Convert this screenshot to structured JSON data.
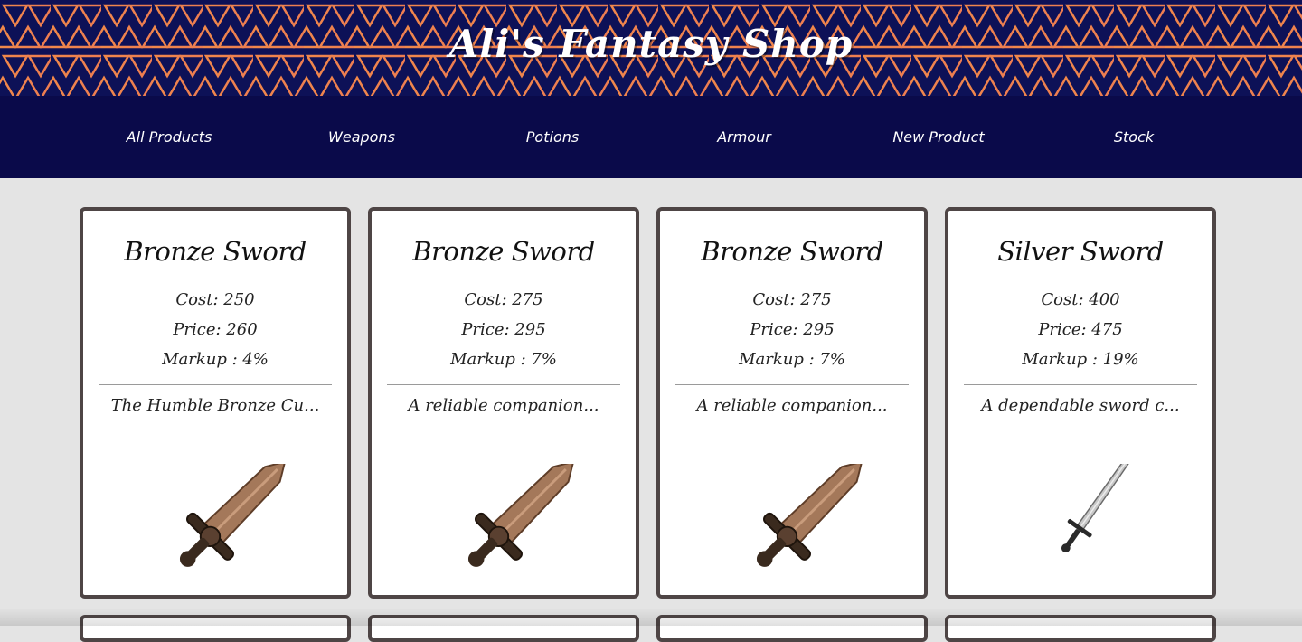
{
  "header": {
    "title": "Ali's Fantasy Shop"
  },
  "nav": {
    "items": [
      {
        "label": "All Products"
      },
      {
        "label": "Weapons"
      },
      {
        "label": "Potions"
      },
      {
        "label": "Armour"
      },
      {
        "label": "New Product"
      },
      {
        "label": "Stock"
      }
    ]
  },
  "products": [
    {
      "name": "Bronze Sword",
      "cost": "Cost: 250",
      "price": "Price: 260",
      "markup": "Markup : 4%",
      "description": "The Humble Bronze Cu...",
      "image_icon": "bronze-sword-icon"
    },
    {
      "name": "Bronze Sword",
      "cost": "Cost: 275",
      "price": "Price: 295",
      "markup": "Markup : 7%",
      "description": "A reliable companion...",
      "image_icon": "bronze-sword-icon"
    },
    {
      "name": "Bronze Sword",
      "cost": "Cost: 275",
      "price": "Price: 295",
      "markup": "Markup : 7%",
      "description": "A reliable companion...",
      "image_icon": "bronze-sword-icon"
    },
    {
      "name": "Silver Sword",
      "cost": "Cost: 400",
      "price": "Price: 475",
      "markup": "Markup : 19%",
      "description": "A dependable sword c...",
      "image_icon": "silver-sword-icon"
    }
  ],
  "colors": {
    "banner_bg": "#0d1157",
    "nav_bg": "#0a0a4a",
    "page_bg": "#e4e4e4",
    "card_border": "#4e4545"
  }
}
